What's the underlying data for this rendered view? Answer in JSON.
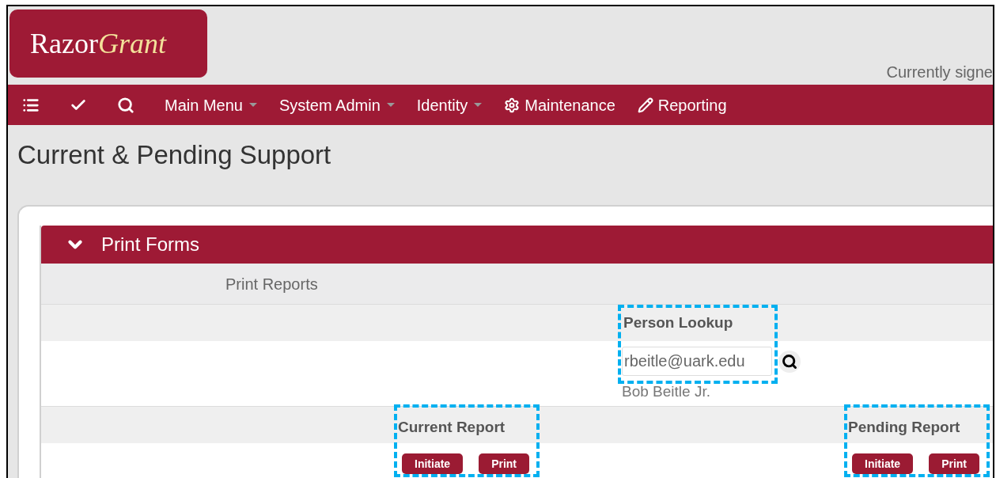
{
  "logo": {
    "first": "Razor",
    "second": "Grant"
  },
  "signed_in": "Currently signe",
  "nav": [
    {
      "kind": "icon"
    },
    {
      "kind": "icon"
    },
    {
      "kind": "icon"
    },
    {
      "kind": "text",
      "label": "Main Menu",
      "dropdown": true
    },
    {
      "kind": "text",
      "label": "System Admin",
      "dropdown": true
    },
    {
      "kind": "text",
      "label": "Identity",
      "dropdown": true
    },
    {
      "kind": "text",
      "label": "Maintenance",
      "dropdown": false
    },
    {
      "kind": "text",
      "label": "Reporting",
      "dropdown": false
    }
  ],
  "page_title": "Current & Pending Support",
  "panel": {
    "title": "Print Forms",
    "expanded": true,
    "section_label": "Print Reports",
    "person_lookup": {
      "label": "Person Lookup",
      "value": "rbeitle@uark.edu",
      "name": "Bob Beitle Jr."
    },
    "reports": [
      {
        "label": "Current Report",
        "buttons": [
          "Initiate",
          "Print"
        ]
      },
      {
        "label": "Pending Report",
        "buttons": [
          "Initiate",
          "Print"
        ]
      }
    ]
  }
}
